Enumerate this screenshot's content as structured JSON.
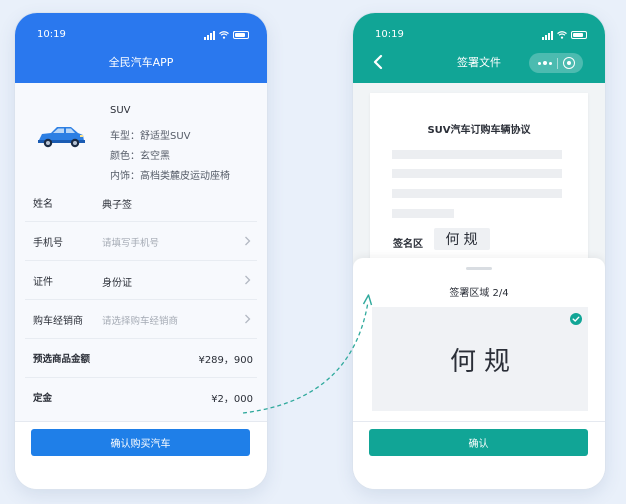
{
  "left_phone": {
    "status": {
      "time": "10:19"
    },
    "header": {
      "title": "全民汽车APP"
    },
    "car": {
      "name": "SUV",
      "specs": [
        {
          "label": "车型：",
          "value": "舒适型SUV"
        },
        {
          "label": "颜色：",
          "value": "玄空黑"
        },
        {
          "label": "内饰：",
          "value": "高档类麓皮运动座椅"
        }
      ]
    },
    "form": {
      "name": {
        "label": "姓名",
        "value": "典子签"
      },
      "phone": {
        "label": "手机号",
        "placeholder": "请填写手机号"
      },
      "id_type": {
        "label": "证件",
        "value": "身份证"
      },
      "dealer": {
        "label": "购车经销商",
        "placeholder": "请选择购车经销商"
      },
      "amount": {
        "label": "预选商品金额",
        "value": "¥289，900"
      },
      "deposit": {
        "label": "定金",
        "value": "¥2，000"
      }
    },
    "footer": {
      "button_label": "确认购买汽车"
    }
  },
  "right_phone": {
    "status": {
      "time": "10:19"
    },
    "header": {
      "title": "签署文件"
    },
    "document": {
      "title": "SUV汽车订购车辆协议",
      "sign_label": "签名区",
      "signature": "何规"
    },
    "sheet": {
      "title": "签署区域 2/4",
      "signature": "何规"
    },
    "footer": {
      "button_label": "确认"
    }
  },
  "colors": {
    "left_accent": "#2a78ee",
    "right_accent": "#11a596",
    "background": "#e9f0fa"
  },
  "icons": [
    "signal-icon",
    "wifi-icon",
    "battery-icon",
    "car-icon",
    "chevron-right-icon",
    "back-arrow-icon",
    "more-dots-icon",
    "target-icon",
    "check-circle-icon"
  ]
}
